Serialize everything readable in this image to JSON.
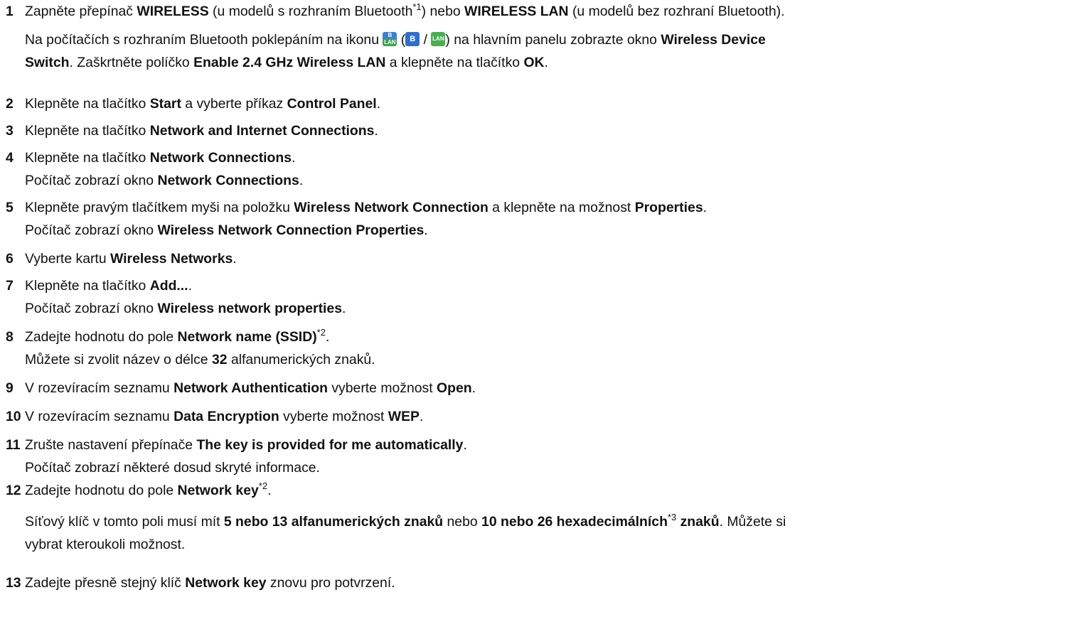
{
  "steps": [
    {
      "num": "1",
      "lines": [
        [
          "Zapněte přepínač ",
          {
            "b": "WIRELESS"
          },
          " (u modelů s rozhraním Bluetooth",
          {
            "sup": "*1"
          },
          ") nebo ",
          {
            "b": "WIRELESS LAN"
          },
          " (u modelů bez rozhraní Bluetooth)."
        ],
        [
          "Na počítačích s rozhraním Bluetooth poklepáním na ikonu ",
          {
            "icon": "wireless-combo-icon"
          },
          " (",
          {
            "icon": "bluetooth-icon"
          },
          " / ",
          {
            "icon": "lan-icon"
          },
          ") na hlavním panelu zobrazte okno ",
          {
            "b": "Wireless Device"
          }
        ],
        [
          {
            "b": "Switch"
          },
          ". Zaškrtněte políčko ",
          {
            "b": "Enable 2.4 GHz Wireless LAN"
          },
          " a klepněte na tlačítko ",
          {
            "b": "OK"
          },
          "."
        ]
      ]
    },
    {
      "num": "2",
      "lines": [
        [
          "Klepněte na tlačítko ",
          {
            "b": "Start"
          },
          " a vyberte příkaz ",
          {
            "b": "Control Panel"
          },
          "."
        ]
      ]
    },
    {
      "num": "3",
      "lines": [
        [
          "Klepněte na tlačítko ",
          {
            "b": "Network and Internet Connections"
          },
          "."
        ]
      ]
    },
    {
      "num": "4",
      "lines": [
        [
          "Klepněte na tlačítko ",
          {
            "b": "Network Connections"
          },
          "."
        ],
        [
          "Počítač zobrazí okno ",
          {
            "b": "Network Connections"
          },
          "."
        ]
      ]
    },
    {
      "num": "5",
      "lines": [
        [
          "Klepněte pravým tlačítkem myši na položku ",
          {
            "b": "Wireless Network Connection"
          },
          " a klepněte na možnost ",
          {
            "b": "Properties"
          },
          "."
        ],
        [
          "Počítač zobrazí okno ",
          {
            "b": "Wireless Network Connection Properties"
          },
          "."
        ]
      ]
    },
    {
      "num": "6",
      "lines": [
        [
          "Vyberte kartu ",
          {
            "b": "Wireless Networks"
          },
          "."
        ]
      ]
    },
    {
      "num": "7",
      "lines": [
        [
          "Klepněte na tlačítko ",
          {
            "b": "Add..."
          },
          "."
        ],
        [
          "Počítač zobrazí okno ",
          {
            "b": "Wireless network properties"
          },
          "."
        ]
      ]
    },
    {
      "num": "8",
      "lines": [
        [
          "Zadejte hodnotu do pole ",
          {
            "b": "Network name (SSID)"
          },
          {
            "sup": "*2"
          },
          "."
        ],
        [
          "Můžete si zvolit název o délce ",
          {
            "b": "32"
          },
          " alfanumerických znaků."
        ]
      ]
    },
    {
      "num": "9",
      "lines": [
        [
          "V rozevíracím seznamu ",
          {
            "b": "Network Authentication"
          },
          " vyberte možnost ",
          {
            "b": "Open"
          },
          "."
        ]
      ]
    },
    {
      "num": "10",
      "lines": [
        [
          "V rozevíracím seznamu ",
          {
            "b": "Data Encryption"
          },
          " vyberte možnost ",
          {
            "b": "WEP"
          },
          "."
        ]
      ]
    },
    {
      "num": "11",
      "lines": [
        [
          "Zrušte nastavení přepínače ",
          {
            "b": "The key is provided for me automatically"
          },
          "."
        ],
        [
          "Počítač zobrazí některé dosud skryté informace."
        ]
      ]
    },
    {
      "num": "12",
      "lines": [
        [
          "Zadejte hodnotu do pole ",
          {
            "b": "Network key"
          },
          {
            "sup": "*2"
          },
          "."
        ],
        [
          "Síťový klíč v tomto poli musí mít ",
          {
            "b": "5 nebo 13 alfanumerických znaků"
          },
          " nebo ",
          {
            "b": "10 nebo 26 hexadecimálních"
          },
          {
            "sup": "*3"
          },
          " ",
          {
            "b": "znaků"
          },
          ". Můžete si"
        ],
        [
          "vybrat kteroukoli možnost."
        ]
      ]
    },
    {
      "num": "13",
      "lines": [
        [
          "Zadejte přesně stejný klíč ",
          {
            "b": "Network key"
          },
          " znovu pro potvrzení."
        ]
      ]
    }
  ],
  "icons": {
    "wireless-combo-icon": {
      "top": "B",
      "bottom": "LAN"
    },
    "bluetooth-icon": {
      "label": "B"
    },
    "lan-icon": {
      "label": "LAN"
    }
  }
}
